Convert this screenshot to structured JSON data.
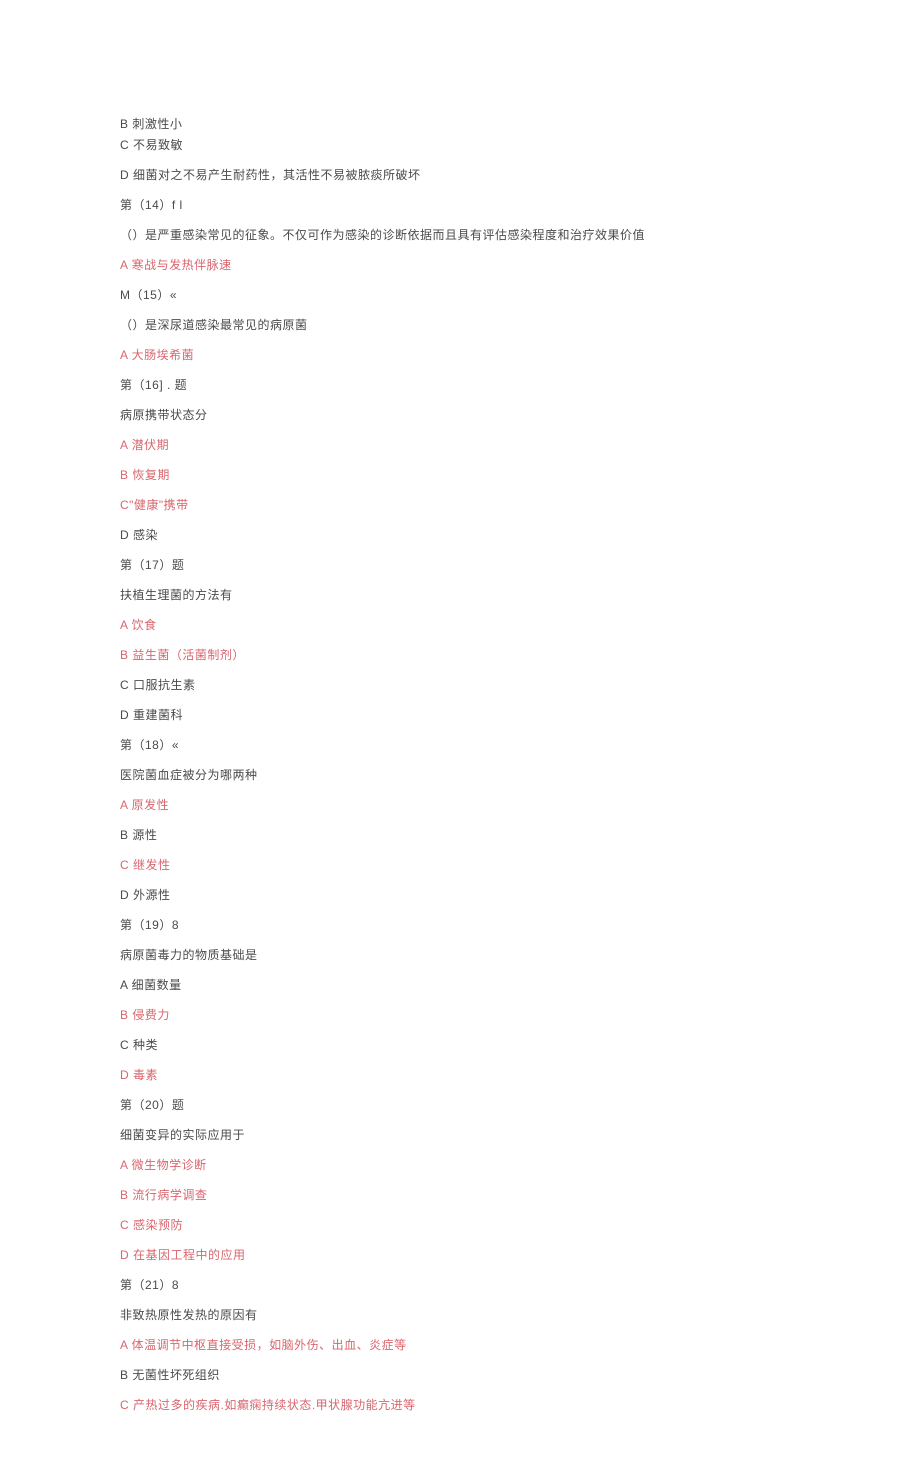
{
  "lines": [
    {
      "text": "B 刺激性小",
      "red": false,
      "tight": true
    },
    {
      "text": "C 不易致敏",
      "red": false,
      "tight": false
    },
    {
      "text": "D 细菌对之不易产生耐药性，其活性不易被脓痰所破坏",
      "red": false,
      "tight": false
    },
    {
      "text": "第（14）f l",
      "red": false,
      "tight": false
    },
    {
      "text": "（）是严重感染常见的征象。不仅可作为感染的诊断依据而且具有评估感染程度和治疗效果价值",
      "red": false,
      "tight": false
    },
    {
      "text": "A 寒战与发热伴脉速",
      "red": true,
      "tight": false
    },
    {
      "text": "M（15）«",
      "red": false,
      "tight": false
    },
    {
      "text": "（）是深尿道感染最常见的病原菌",
      "red": false,
      "tight": false
    },
    {
      "text": "A 大肠埃希菌",
      "red": true,
      "tight": false
    },
    {
      "text": "第（16] . 题",
      "red": false,
      "tight": false
    },
    {
      "text": "病原携带状态分",
      "red": false,
      "tight": false
    },
    {
      "text": "A 潜伏期",
      "red": true,
      "tight": false
    },
    {
      "text": "B 恢复期",
      "red": true,
      "tight": false
    },
    {
      "text": "C\"健康\"携带",
      "red": true,
      "tight": false
    },
    {
      "text": "D 感染",
      "red": false,
      "tight": false
    },
    {
      "text": "第（17）题",
      "red": false,
      "tight": false
    },
    {
      "text": "扶植生理菌的方法有",
      "red": false,
      "tight": false
    },
    {
      "text": "A 饮食",
      "red": true,
      "tight": false
    },
    {
      "text": "B 益生菌（活菌制剂）",
      "red": true,
      "tight": false
    },
    {
      "text": "C 口服抗生素",
      "red": false,
      "tight": false
    },
    {
      "text": "D 重建菌科",
      "red": false,
      "tight": false
    },
    {
      "text": "第（18）«",
      "red": false,
      "tight": false
    },
    {
      "text": "医院菌血症被分为哪两种",
      "red": false,
      "tight": false
    },
    {
      "text": "A 原发性",
      "red": true,
      "tight": false
    },
    {
      "text": "B 源性",
      "red": false,
      "tight": false
    },
    {
      "text": "C 继发性",
      "red": true,
      "tight": false
    },
    {
      "text": "D 外源性",
      "red": false,
      "tight": false
    },
    {
      "text": "第（19）8",
      "red": false,
      "tight": false
    },
    {
      "text": "病原菌毒力的物质基础是",
      "red": false,
      "tight": false
    },
    {
      "text": "A 细菌数量",
      "red": false,
      "tight": false
    },
    {
      "text": "B 侵费力",
      "red": true,
      "tight": false
    },
    {
      "text": "C 种类",
      "red": false,
      "tight": false
    },
    {
      "text": "D 毒素",
      "red": true,
      "tight": false
    },
    {
      "text": "第（20）题",
      "red": false,
      "tight": false
    },
    {
      "text": "细菌变异的实际应用于",
      "red": false,
      "tight": false
    },
    {
      "text": "A 微生物学诊断",
      "red": true,
      "tight": false
    },
    {
      "text": "B 流行病学调查",
      "red": true,
      "tight": false
    },
    {
      "text": "C 感染预防",
      "red": true,
      "tight": false
    },
    {
      "text": "D 在基因工程中的应用",
      "red": true,
      "tight": false
    },
    {
      "text": "第（21）8",
      "red": false,
      "tight": false
    },
    {
      "text": "非致热原性发热的原因有",
      "red": false,
      "tight": false
    },
    {
      "text": "A 体温调节中枢直接受损，如脑外伤、出血、炎症等",
      "red": true,
      "tight": false
    },
    {
      "text": "B 无菌性坏死组织",
      "red": false,
      "tight": false
    },
    {
      "text": "C 产热过多的疾病.如癫痫持续状态.甲状腺功能亢进等",
      "red": true,
      "tight": false
    }
  ]
}
